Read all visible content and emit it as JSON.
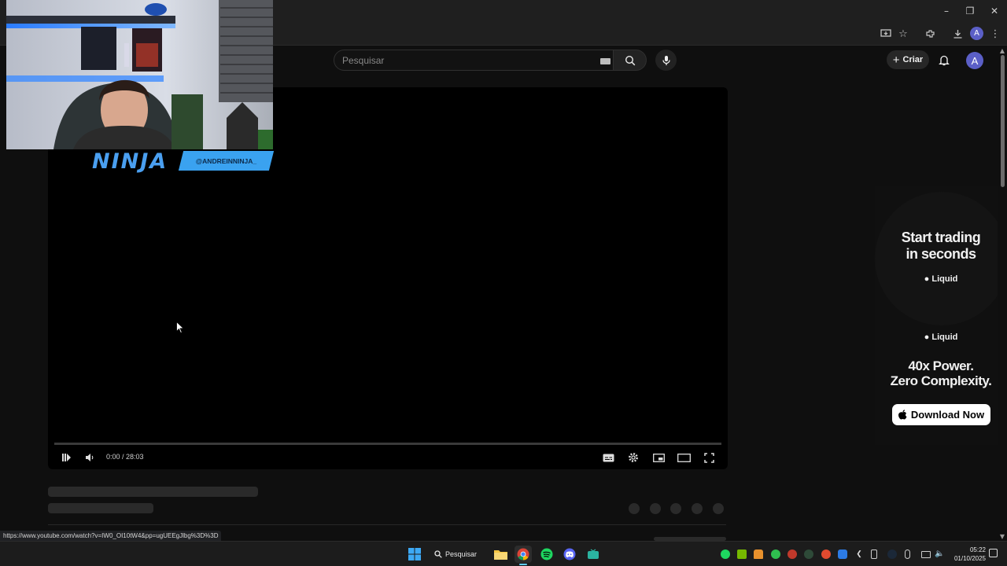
{
  "search": {
    "placeholder": "Pesquisar"
  },
  "masthead": {
    "create_label": "Criar",
    "avatar_letter": "A"
  },
  "browser": {
    "profile_letter": "A"
  },
  "player": {
    "time": "0:00 / 28:03",
    "progress": 0
  },
  "overlay": {
    "logo_text": "NINJA",
    "handle": "@ANDREINNINJA_"
  },
  "ad": {
    "headline1_line1": "Start trading",
    "headline1_line2": "in seconds",
    "brand": "Liquid",
    "headline2_line1": "40x Power.",
    "headline2_line2": "Zero Complexity.",
    "cta": "Download Now"
  },
  "status_url": "https://www.youtube.com/watch?v=IW0_OI10tW4&pp=ugUEEgJlbg%3D%3D",
  "taskbar": {
    "search_label": "Pesquisar",
    "time": "05:22",
    "date": "01/10/2025"
  },
  "colors": {
    "accent": "#5b5fc7",
    "ninja_blue": "#3aa2f0",
    "spotify": "#1ed760",
    "discord": "#5865f2"
  }
}
